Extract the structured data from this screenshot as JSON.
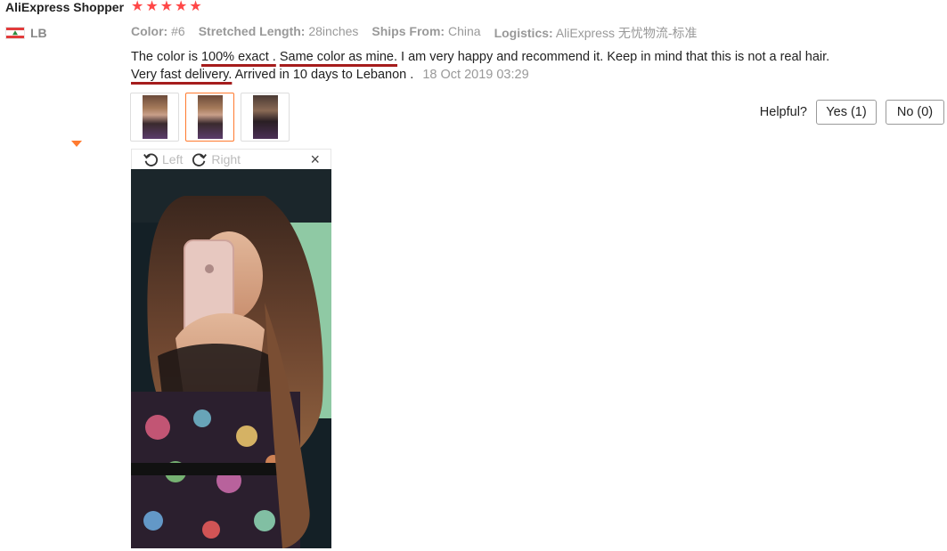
{
  "reviewer": {
    "name": "AliExpress Shopper",
    "rating": 5,
    "country_code": "LB"
  },
  "attributes": [
    {
      "key": "Color:",
      "value": "#6"
    },
    {
      "key": "Stretched Length:",
      "value": "28inches"
    },
    {
      "key": "Ships From:",
      "value": "China"
    },
    {
      "key": "Logistics:",
      "value": "AliExpress 无忧物流-标准"
    }
  ],
  "review": {
    "p1": "The color is ",
    "u1": "100% exact .",
    "p2": " ",
    "u2": "Same color as mine.",
    "p3": " I am very happy and recommend it. Keep in mind that this is not a real hair. ",
    "u3": "Very fast delivery.",
    "p4": " Arrived in 10 days to Lebanon . ",
    "date": "18 Oct 2019 03:29"
  },
  "thumbnails": [
    {
      "alt": "review photo 1",
      "selected": false
    },
    {
      "alt": "review photo 2",
      "selected": true
    },
    {
      "alt": "review photo 3",
      "selected": false
    }
  ],
  "helpful": {
    "label": "Helpful?",
    "yes": "Yes (1)",
    "no": "No (0)"
  },
  "viewer": {
    "rotate_left": "Left",
    "rotate_right": "Right",
    "close": "×"
  },
  "icons": {
    "star": "star-icon",
    "rotate_left": "rotate-left-icon",
    "rotate_right": "rotate-right-icon",
    "close": "close-icon",
    "flag": "lebanon-flag-icon"
  },
  "colors": {
    "star": "#ff4747",
    "accent": "#ff7a2f",
    "underline": "#a51c1c",
    "muted": "#999999"
  }
}
